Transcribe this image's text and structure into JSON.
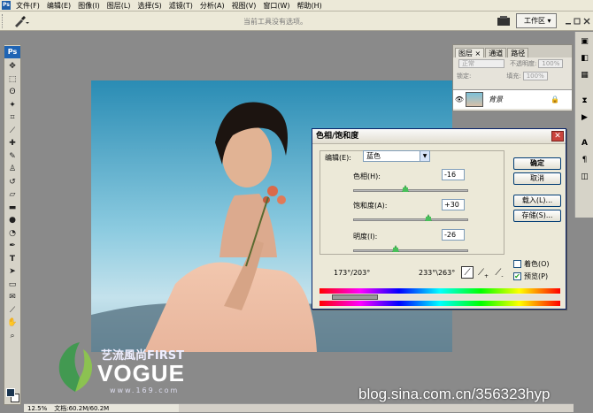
{
  "menu": {
    "items": [
      "文件(F)",
      "编辑(E)",
      "图像(I)",
      "图层(L)",
      "选择(S)",
      "滤镜(T)",
      "分析(A)",
      "视图(V)",
      "窗口(W)",
      "帮助(H)"
    ]
  },
  "options_bar": {
    "hint": "当前工具没有选项。",
    "workspace_label": "工作区 ▾"
  },
  "toolbox": {
    "logo": "Ps"
  },
  "status_bar": {
    "zoom": "12.5%",
    "doc_info": "文档:60.2M/60.2M"
  },
  "layers_panel": {
    "tabs": [
      "图层 ×",
      "通道",
      "路径"
    ],
    "blend_mode": "正常",
    "opacity_label": "不透明度:",
    "opacity_value": "100%",
    "lock_label": "锁定:",
    "fill_label": "填充:",
    "fill_value": "100%",
    "layer_name": "背景"
  },
  "hue_sat_dialog": {
    "title": "色相/饱和度",
    "edit_label": "编辑(E):",
    "edit_value": "蓝色",
    "hue_label": "色相(H):",
    "hue_value": "-16",
    "hue_level": -16,
    "saturation_label": "饱和度(A):",
    "saturation_value": "+30",
    "saturation_level": 30,
    "lightness_label": "明度(I):",
    "lightness_value": "-26",
    "lightness_level": -26,
    "range_left": "173°/203°",
    "range_right": "233°\\263°",
    "ok_label": "确定",
    "cancel_label": "取消",
    "load_label": "载入(L)...",
    "save_label": "存储(S)...",
    "colorize_label": "着色(O)",
    "preview_label": "预览(P)"
  },
  "watermark": {
    "line1": "艺流風尚FIRST",
    "line2": "VOGUE",
    "line3": "www.169.com"
  },
  "blog_url": "blog.sina.com.cn/356323hyp"
}
